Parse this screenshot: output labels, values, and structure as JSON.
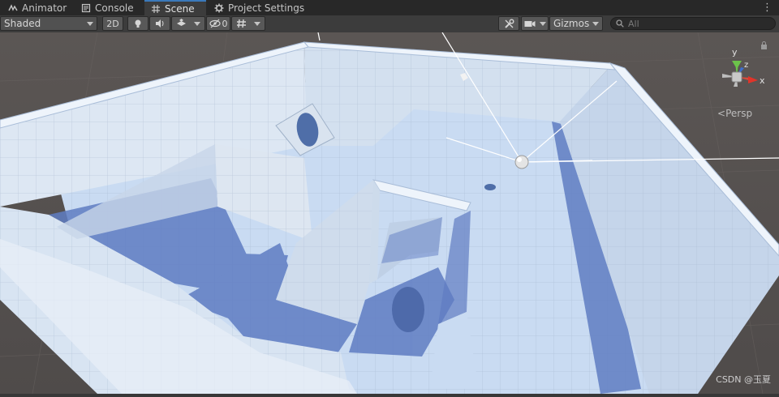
{
  "tabs": [
    {
      "label": "Animator",
      "icon": "animator-icon"
    },
    {
      "label": "Console",
      "icon": "console-icon"
    },
    {
      "label": "Scene",
      "icon": "scene-grid-icon",
      "active": true
    },
    {
      "label": "Project Settings",
      "icon": "gear-icon"
    }
  ],
  "toolbar": {
    "shading_mode": "Shaded",
    "mode_2d": "2D",
    "hidden_count": "0",
    "gizmos_label": "Gizmos",
    "search_placeholder": "All"
  },
  "scene": {
    "camera_mode": "Persp",
    "axis_y": "y",
    "axis_x": "x",
    "axis_z": "z"
  },
  "watermark": "CSDN @玉夏",
  "colors": {
    "sky": "#5a5553",
    "floor": "#c9dbf2",
    "wall": "#dde7f3",
    "shadow": "#5f7cc2",
    "accent_tab": "#3a79bb"
  }
}
